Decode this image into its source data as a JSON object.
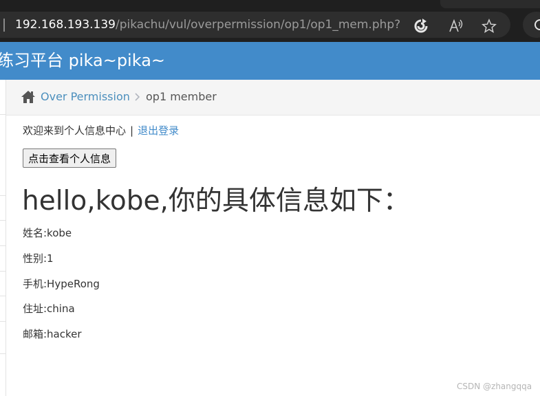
{
  "browser": {
    "url_host": "192.168.193.139",
    "url_path": "/pikachu/vul/overpermission/op1/op1_mem.php?user...",
    "icons": [
      "refresh-icon",
      "read-aloud-icon",
      "favorite-star-icon"
    ]
  },
  "app": {
    "title": "练习平台 pika~pika~",
    "header_color": "#428bca"
  },
  "breadcrumb": {
    "link": "Over Permission",
    "current": "op1 member"
  },
  "welcome": {
    "text": "欢迎来到个人信息中心",
    "separator": "|",
    "logout": "退出登录"
  },
  "view_button": "点击查看个人信息",
  "greeting": "hello,kobe,你的具体信息如下：",
  "info": {
    "name": "姓名:kobe",
    "gender": "性别:1",
    "phone": "手机:HypeRong",
    "address": "住址:china",
    "email": "邮箱:hacker"
  },
  "watermark": "CSDN @zhangqqa"
}
